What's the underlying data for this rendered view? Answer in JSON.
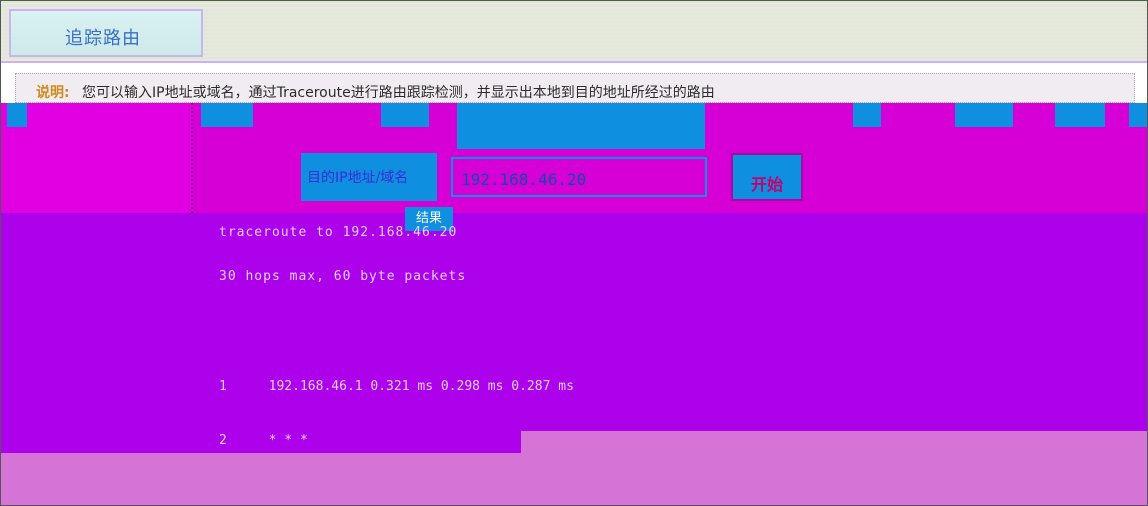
{
  "tab": {
    "title": "追踪路由"
  },
  "description": {
    "label": "说明:",
    "text": "您可以输入IP地址或域名，通过Traceroute进行路由跟踪检测，并显示出本地到目的地址所经过的路由"
  },
  "form": {
    "label": "目的IP地址/域名",
    "value": "192.168.46.20",
    "button_label": "开始"
  },
  "output": {
    "tab_label": "结果",
    "header_line": "traceroute to 192.168.46.20",
    "sub_line": "30 hops max, 60 byte packets",
    "hops": [
      {
        "num": "1",
        "text": "192.168.46.1  0.321 ms  0.298 ms  0.287 ms"
      },
      {
        "num": "2",
        "text": "* * *"
      }
    ]
  },
  "colors": {
    "accent": "#0e8fe0",
    "magenta": "#d600d6",
    "purple": "#ad00eb",
    "pink": "#d673d6"
  }
}
